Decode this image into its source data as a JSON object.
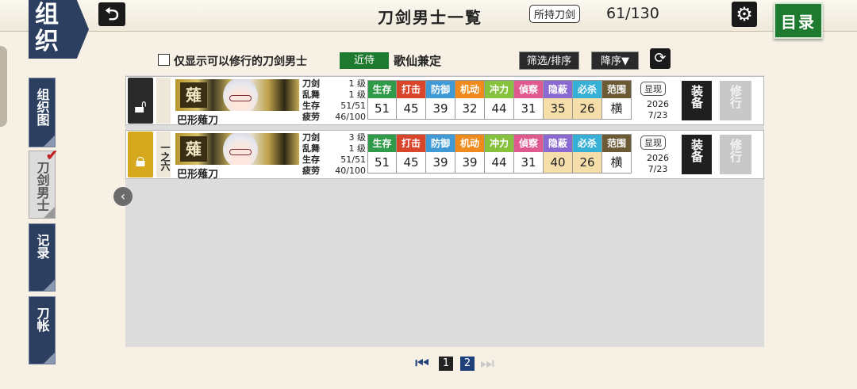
{
  "header": {
    "org_badge": [
      "组",
      "织"
    ],
    "title": "刀剑男士一覧",
    "owned_label": "所持刀剑",
    "owned_count": "61/130",
    "menu_label": "目录"
  },
  "side_tabs": [
    {
      "label": "组织图",
      "active": false
    },
    {
      "label": "刀剑男士",
      "active": true
    },
    {
      "label": "记录",
      "active": false
    },
    {
      "label": "刀帐",
      "active": false
    }
  ],
  "filter": {
    "only_trainable_label": "仅显示可以修行的刀剑男士",
    "slot_badge": "近侍",
    "slot_name": "歌仙兼定",
    "sort_filter_label": "筛选/排序",
    "order_label": "降序▼"
  },
  "stat_headers": [
    {
      "label": "生存",
      "color": "#2f9a48"
    },
    {
      "label": "打击",
      "color": "#d9452b"
    },
    {
      "label": "防御",
      "color": "#3f9ad6"
    },
    {
      "label": "机动",
      "color": "#ef8a1c"
    },
    {
      "label": "冲力",
      "color": "#86c23e"
    },
    {
      "label": "偵察",
      "color": "#e05a8f"
    },
    {
      "label": "隐蔽",
      "color": "#8a6ad1"
    },
    {
      "label": "必杀",
      "color": "#37b0d6"
    },
    {
      "label": "范围",
      "color": "#6b5a34"
    }
  ],
  "rows": [
    {
      "locked": false,
      "lock_color": "#2a2a2a",
      "rank": "",
      "crest": "薙",
      "name": "巴形薙刀",
      "info": [
        {
          "k": "刀剑",
          "v": "1 级"
        },
        {
          "k": "乱舞",
          "v": "1 级"
        },
        {
          "k": "生存",
          "v": "51/51"
        },
        {
          "k": "疲劳",
          "v": "46/100"
        }
      ],
      "stats": [
        "51",
        "45",
        "39",
        "32",
        "44",
        "31",
        "35",
        "26",
        "横"
      ],
      "shown_label": "显现",
      "date_year": "2026",
      "date_md": "7/23",
      "equip_label": "装备",
      "train_label": "修行"
    },
    {
      "locked": true,
      "lock_color": "#d6a81e",
      "rank": "一之六",
      "crest": "薙",
      "name": "巴形薙刀",
      "info": [
        {
          "k": "刀剑",
          "v": "3 级"
        },
        {
          "k": "乱舞",
          "v": "1 级"
        },
        {
          "k": "生存",
          "v": "51/51"
        },
        {
          "k": "疲劳",
          "v": "40/100"
        }
      ],
      "stats": [
        "51",
        "45",
        "39",
        "39",
        "44",
        "31",
        "40",
        "26",
        "横"
      ],
      "shown_label": "显现",
      "date_year": "2026",
      "date_md": "7/23",
      "equip_label": "装备",
      "train_label": "修行"
    }
  ],
  "pager": {
    "pages": [
      "1",
      "2"
    ],
    "current": "1"
  }
}
